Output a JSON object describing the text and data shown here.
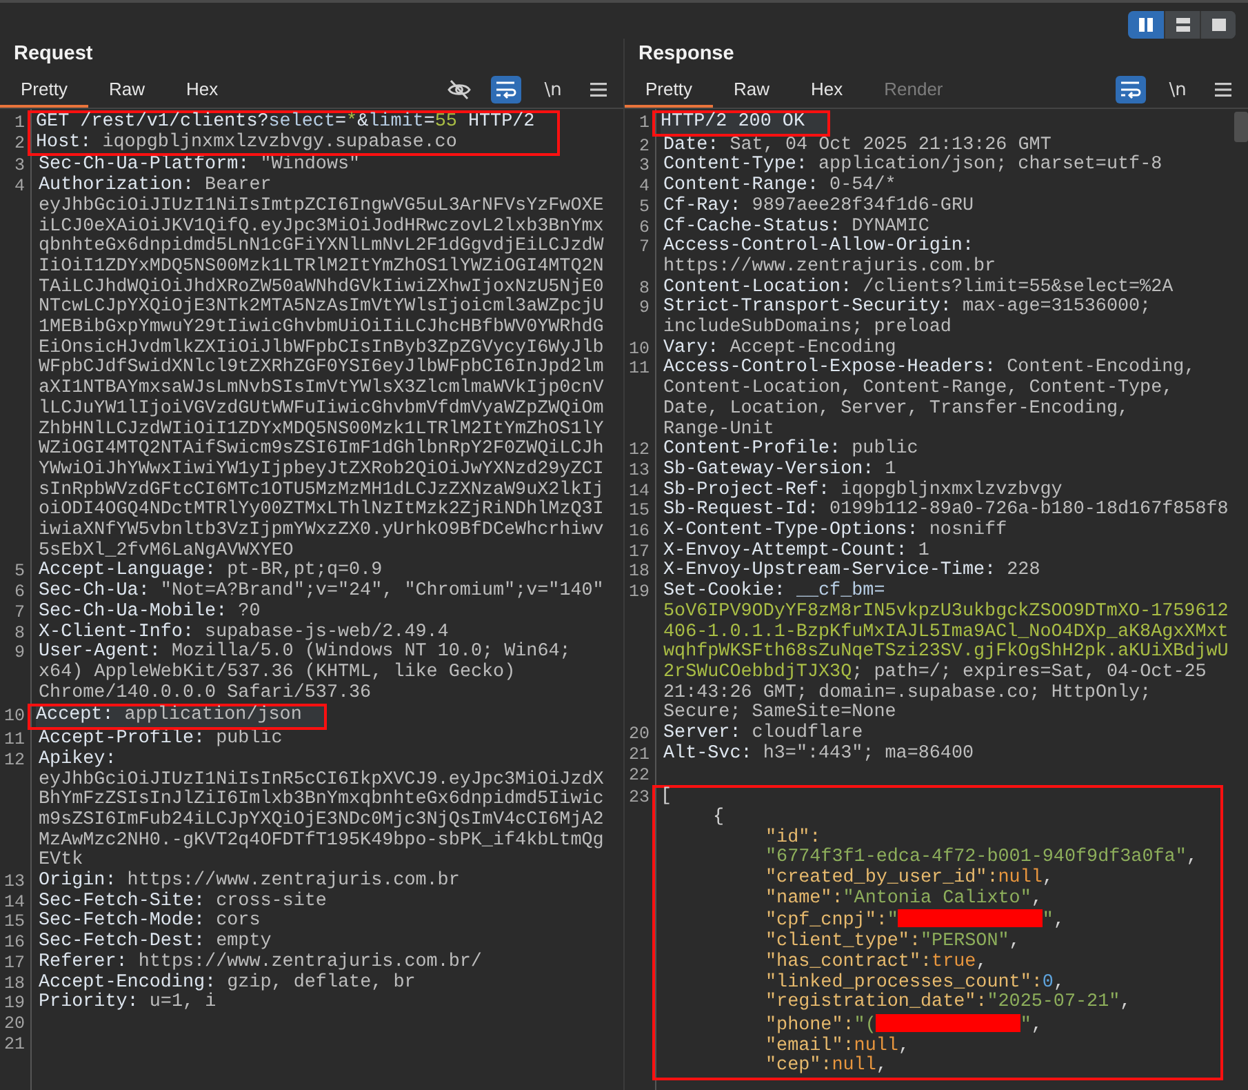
{
  "layout_buttons": [
    {
      "kind": "columns",
      "selected": true
    },
    {
      "kind": "rows",
      "selected": false
    },
    {
      "kind": "single",
      "selected": false
    }
  ],
  "request": {
    "title": "Request",
    "tabs": [
      {
        "label": "Pretty",
        "selected": true,
        "disabled": false
      },
      {
        "label": "Raw",
        "selected": false,
        "disabled": false
      },
      {
        "label": "Hex",
        "selected": false,
        "disabled": false
      }
    ],
    "tools": [
      {
        "kind": "hide",
        "on": false
      },
      {
        "kind": "wrap",
        "on": true
      },
      {
        "kind": "newline",
        "label": "\\n",
        "on": false
      },
      {
        "kind": "menu"
      }
    ],
    "lines": [
      {
        "n": "1",
        "highlighted": false,
        "boxed": true,
        "parts": [
          {
            "kind": "name",
            "text": "GET /rest/v1/clients?"
          },
          {
            "kind": "pname",
            "text": "select"
          },
          {
            "kind": "name",
            "text": "="
          },
          {
            "kind": "pval",
            "text": "*"
          },
          {
            "kind": "name",
            "text": "&"
          },
          {
            "kind": "pname",
            "text": "limit"
          },
          {
            "kind": "name",
            "text": "="
          },
          {
            "kind": "pval",
            "text": "55"
          },
          {
            "kind": "name",
            "text": " HTTP/2"
          }
        ]
      },
      {
        "n": "2",
        "highlighted": false,
        "boxed": true,
        "parts": [
          {
            "kind": "name",
            "text": "Host: "
          },
          {
            "kind": "value",
            "text": "iqopgbljnxmxlzvzbvgy.supabase.co"
          }
        ]
      },
      {
        "n": "3",
        "highlighted": false,
        "boxed": false,
        "parts": [
          {
            "kind": "name",
            "text": "Sec-Ch-Ua-Platform: "
          },
          {
            "kind": "value",
            "text": "\"Windows\""
          }
        ]
      },
      {
        "n": "4",
        "highlighted": false,
        "boxed": false,
        "parts": [
          {
            "kind": "name",
            "text": "Authorization: "
          },
          {
            "kind": "value",
            "text": "Bearer eyJhbGciOiJIUzI1NiIsImtpZCI6IngwVG5uL3ArNFVsYzFwOXEiLCJ0eXAiOiJKV1QifQ.eyJpc3MiOiJodHRwczovL2lxb3BnYmxqbnhteGx6dnpidmd5LnN1cGFiYXNlLmNvL2F1dGgvdjEiLCJzdWIiOiI1ZDYxMDQ5NS00Mzk1LTRlM2ItYmZhOS1lYWZiOGI4MTQ2NTAiLCJhdWQiOiJhdXRoZW50aWNhdGVkIiwiZXhwIjoxNzU5NjE0NTcwLCJpYXQiOjE3NTk2MTA5NzAsImVtYWlsIjoicml3aWZpcjU1MEBibGxpYmwuY29tIiwicGhvbmUiOiIiLCJhcHBfbWV0YWRhdGEiOnsicHJvdmlkZXIiOiJlbWFpbCIsInByb3ZpZGVycyI6WyJlbWFpbCJdfSwidXNlcl9tZXRhZGF0YSI6eyJlbWFpbCI6InJpd2lmaXI1NTBAYmxsaWJsLmNvbSIsImVtYWlsX3ZlcmlmaWVkIjp0cnVlLCJuYW1lIjoiVGVzdGUtWWFuIiwicGhvbmVfdmVyaWZpZWQiOmZhbHNlLCJzdWIiOiI1ZDYxMDQ5NS00Mzk1LTRlM2ItYmZhOS1lYWZiOGI4MTQ2NTAifSwicm9sZSI6ImF1dGhlbnRpY2F0ZWQiLCJhYWwiOiJhYWwxIiwiYW1yIjpbeyJtZXRob2QiOiJwYXNzd29yZCIsInRpbWVzdGFtcCI6MTc1OTU5MzMzMH1dLCJzZXNzaW9uX2lkIjoiODI4OGQ4NDctMTRlYy00ZTMxLThlNzItMzk2ZjRiNDhlMzQ3IiwiaXNfYW5vbnltb3VzIjpmYWxzZX0.yUrhkO9BfDCeWhcrhiwv5sEbXl_2fvM6LaNgAVWXYEO"
          }
        ]
      },
      {
        "n": "5",
        "highlighted": false,
        "boxed": false,
        "parts": [
          {
            "kind": "name",
            "text": "Accept-Language: "
          },
          {
            "kind": "value",
            "text": "pt-BR,pt;q=0.9"
          }
        ]
      },
      {
        "n": "6",
        "highlighted": false,
        "boxed": false,
        "parts": [
          {
            "kind": "name",
            "text": "Sec-Ch-Ua: "
          },
          {
            "kind": "value",
            "text": "\"Not=A?Brand\";v=\"24\", \"Chromium\";v=\"140\""
          }
        ]
      },
      {
        "n": "7",
        "highlighted": false,
        "boxed": false,
        "parts": [
          {
            "kind": "name",
            "text": "Sec-Ch-Ua-Mobile: "
          },
          {
            "kind": "value",
            "text": "?0"
          }
        ]
      },
      {
        "n": "8",
        "highlighted": false,
        "boxed": false,
        "parts": [
          {
            "kind": "name",
            "text": "X-Client-Info: "
          },
          {
            "kind": "value",
            "text": "supabase-js-web/2.49.4"
          }
        ]
      },
      {
        "n": "9",
        "highlighted": false,
        "boxed": false,
        "parts": [
          {
            "kind": "name",
            "text": "User-Agent: "
          },
          {
            "kind": "value",
            "text": "Mozilla/5.0 (Windows NT 10.0; Win64; x64) AppleWebKit/537.36 (KHTML, like Gecko) Chrome/140.0.0.0 Safari/537.36"
          }
        ]
      },
      {
        "n": "10",
        "highlighted": true,
        "boxed": true,
        "parts": [
          {
            "kind": "name",
            "text": "Accept: "
          },
          {
            "kind": "value",
            "text": "application/json"
          }
        ]
      },
      {
        "n": "11",
        "highlighted": false,
        "boxed": false,
        "parts": [
          {
            "kind": "name",
            "text": "Accept-Profile: "
          },
          {
            "kind": "value",
            "text": "public"
          }
        ]
      },
      {
        "n": "12",
        "highlighted": false,
        "boxed": false,
        "parts": [
          {
            "kind": "name",
            "text": "Apikey: "
          },
          {
            "kind": "value",
            "text": "eyJhbGciOiJIUzI1NiIsInR5cCI6IkpXVCJ9.eyJpc3MiOiJzdXBhYmFzZSIsInJlZiI6Imlxb3BnYmxqbnhteGx6dnpidmd5Iiwicm9sZSI6ImFub24iLCJpYXQiOjE3NDc0Mjc3NjQsImV4cCI6MjA2MzAwMzc2NH0.-gKVT2q4OFDTfT195K49bpo-sbPK_if4kbLtmQgEVtk"
          }
        ]
      },
      {
        "n": "13",
        "highlighted": false,
        "boxed": false,
        "parts": [
          {
            "kind": "name",
            "text": "Origin: "
          },
          {
            "kind": "value",
            "text": "https://www.zentrajuris.com.br"
          }
        ]
      },
      {
        "n": "14",
        "highlighted": false,
        "boxed": false,
        "parts": [
          {
            "kind": "name",
            "text": "Sec-Fetch-Site: "
          },
          {
            "kind": "value",
            "text": "cross-site"
          }
        ]
      },
      {
        "n": "15",
        "highlighted": false,
        "boxed": false,
        "parts": [
          {
            "kind": "name",
            "text": "Sec-Fetch-Mode: "
          },
          {
            "kind": "value",
            "text": "cors"
          }
        ]
      },
      {
        "n": "16",
        "highlighted": false,
        "boxed": false,
        "parts": [
          {
            "kind": "name",
            "text": "Sec-Fetch-Dest: "
          },
          {
            "kind": "value",
            "text": "empty"
          }
        ]
      },
      {
        "n": "17",
        "highlighted": false,
        "boxed": false,
        "parts": [
          {
            "kind": "name",
            "text": "Referer: "
          },
          {
            "kind": "value",
            "text": "https://www.zentrajuris.com.br/"
          }
        ]
      },
      {
        "n": "18",
        "highlighted": false,
        "boxed": false,
        "parts": [
          {
            "kind": "name",
            "text": "Accept-Encoding: "
          },
          {
            "kind": "value",
            "text": "gzip, deflate, br"
          }
        ]
      },
      {
        "n": "19",
        "highlighted": false,
        "boxed": false,
        "parts": [
          {
            "kind": "name",
            "text": "Priority: "
          },
          {
            "kind": "value",
            "text": "u=1, i"
          }
        ]
      },
      {
        "n": "20",
        "highlighted": false,
        "boxed": false
      },
      {
        "n": "21",
        "highlighted": false,
        "boxed": false
      }
    ]
  },
  "response": {
    "title": "Response",
    "tabs": [
      {
        "label": "Pretty",
        "selected": true,
        "disabled": false
      },
      {
        "label": "Raw",
        "selected": false,
        "disabled": false
      },
      {
        "label": "Hex",
        "selected": false,
        "disabled": false
      },
      {
        "label": "Render",
        "selected": false,
        "disabled": true
      }
    ],
    "tools": [
      {
        "kind": "wrap",
        "on": true
      },
      {
        "kind": "newline",
        "label": "\\n",
        "on": false
      },
      {
        "kind": "menu"
      }
    ],
    "lines": [
      {
        "n": "1",
        "highlighted": true,
        "boxed": true,
        "parts": [
          {
            "kind": "name",
            "text": "HTTP/2 200 OK"
          }
        ]
      },
      {
        "n": "2",
        "highlighted": false,
        "boxed": false,
        "parts": [
          {
            "kind": "name",
            "text": "Date: "
          },
          {
            "kind": "value",
            "text": "Sat, 04 Oct 2025 21:13:26 GMT"
          }
        ]
      },
      {
        "n": "3",
        "highlighted": false,
        "boxed": false,
        "parts": [
          {
            "kind": "name",
            "text": "Content-Type: "
          },
          {
            "kind": "value",
            "text": "application/json; charset=utf-8"
          }
        ]
      },
      {
        "n": "4",
        "highlighted": false,
        "boxed": false,
        "parts": [
          {
            "kind": "name",
            "text": "Content-Range: "
          },
          {
            "kind": "value",
            "text": "0-54/*"
          }
        ]
      },
      {
        "n": "5",
        "highlighted": false,
        "boxed": false,
        "parts": [
          {
            "kind": "name",
            "text": "Cf-Ray: "
          },
          {
            "kind": "value",
            "text": "9897aee28f34f1d6-GRU"
          }
        ]
      },
      {
        "n": "6",
        "highlighted": false,
        "boxed": false,
        "parts": [
          {
            "kind": "name",
            "text": "Cf-Cache-Status: "
          },
          {
            "kind": "value",
            "text": "DYNAMIC"
          }
        ]
      },
      {
        "n": "7",
        "highlighted": false,
        "boxed": false,
        "parts": [
          {
            "kind": "name",
            "text": "Access-Control-Allow-Origin: "
          },
          {
            "kind": "value",
            "text": "https://www.zentrajuris.com.br"
          }
        ]
      },
      {
        "n": "8",
        "highlighted": false,
        "boxed": false,
        "parts": [
          {
            "kind": "name",
            "text": "Content-Location: "
          },
          {
            "kind": "value",
            "text": "/clients?limit=55&select=%2A"
          }
        ]
      },
      {
        "n": "9",
        "highlighted": false,
        "boxed": false,
        "parts": [
          {
            "kind": "name",
            "text": "Strict-Transport-Security: "
          },
          {
            "kind": "value",
            "text": "max-age=31536000; includeSubDomains; preload"
          }
        ]
      },
      {
        "n": "10",
        "highlighted": false,
        "boxed": false,
        "parts": [
          {
            "kind": "name",
            "text": "Vary: "
          },
          {
            "kind": "value",
            "text": "Accept-Encoding"
          }
        ]
      },
      {
        "n": "11",
        "highlighted": false,
        "boxed": false,
        "parts": [
          {
            "kind": "name",
            "text": "Access-Control-Expose-Headers: "
          },
          {
            "kind": "value",
            "text": "Content-Encoding, Content-Location, Content-Range, Content-Type, Date, Location, Server, Transfer-Encoding, Range-Unit"
          }
        ]
      },
      {
        "n": "12",
        "highlighted": false,
        "boxed": false,
        "parts": [
          {
            "kind": "name",
            "text": "Content-Profile: "
          },
          {
            "kind": "value",
            "text": "public"
          }
        ]
      },
      {
        "n": "13",
        "highlighted": false,
        "boxed": false,
        "parts": [
          {
            "kind": "name",
            "text": "Sb-Gateway-Version: "
          },
          {
            "kind": "value",
            "text": "1"
          }
        ]
      },
      {
        "n": "14",
        "highlighted": false,
        "boxed": false,
        "parts": [
          {
            "kind": "name",
            "text": "Sb-Project-Ref: "
          },
          {
            "kind": "value",
            "text": "iqopgbljnxmxlzvzbvgy"
          }
        ]
      },
      {
        "n": "15",
        "highlighted": false,
        "boxed": false,
        "parts": [
          {
            "kind": "name",
            "text": "Sb-Request-Id: "
          },
          {
            "kind": "value",
            "text": "0199b112-89a0-726a-b180-18d167f858f8"
          }
        ]
      },
      {
        "n": "16",
        "highlighted": false,
        "boxed": false,
        "parts": [
          {
            "kind": "name",
            "text": "X-Content-Type-Options: "
          },
          {
            "kind": "value",
            "text": "nosniff"
          }
        ]
      },
      {
        "n": "17",
        "highlighted": false,
        "boxed": false,
        "parts": [
          {
            "kind": "name",
            "text": "X-Envoy-Attempt-Count: "
          },
          {
            "kind": "value",
            "text": "1"
          }
        ]
      },
      {
        "n": "18",
        "highlighted": false,
        "boxed": false,
        "parts": [
          {
            "kind": "name",
            "text": "X-Envoy-Upstream-Service-Time: "
          },
          {
            "kind": "value",
            "text": "228"
          }
        ]
      },
      {
        "n": "19",
        "highlighted": false,
        "boxed": false,
        "parts": [
          {
            "kind": "name",
            "text": "Set-Cookie: "
          },
          {
            "kind": "pname",
            "text": "__cf_bm="
          },
          {
            "kind": "pval",
            "text": "5oV6IPV9ODyYF8zM8rIN5vkpzU3ukbgckZSOO9DTmXO-1759612406-1.0.1.1-BzpKfuMxIAJL5Ima9ACl_NoO4DXp_aK8AgxXMxtwqhfpWKSFth68sZuNqeTSzi23SV.gjFkOgShH2pk.aKUiXBdjwU2rSWuCOebbdjTJX3Q"
          },
          {
            "kind": "value",
            "text": "; path=/; expires=Sat, 04-Oct-25 21:43:26 GMT; domain=.supabase.co; HttpOnly; Secure; SameSite=None"
          }
        ]
      },
      {
        "n": "20",
        "highlighted": false,
        "boxed": false,
        "parts": [
          {
            "kind": "name",
            "text": "Server: "
          },
          {
            "kind": "value",
            "text": "cloudflare"
          }
        ]
      },
      {
        "n": "21",
        "highlighted": false,
        "boxed": false,
        "parts": [
          {
            "kind": "name",
            "text": "Alt-Svc: "
          },
          {
            "kind": "value",
            "text": "h3=\":443\"; ma=86400"
          }
        ]
      },
      {
        "n": "22",
        "highlighted": false,
        "boxed": false
      },
      {
        "n": "23",
        "highlighted": false,
        "boxed": true,
        "parts": [
          {
            "kind": "punct",
            "text": "["
          }
        ],
        "children": [
          {
            "parts": [
              {
                "kind": "punct",
                "text": "{"
              }
            ],
            "children": [
              {
                "parts": [
                  {
                    "kind": "jkey",
                    "text": "\"id\":"
                  },
                  {
                    "kind": "jstr",
                    "text": "\"6774f3f1-edca-4f72-b001-940f9df3a0fa\""
                  },
                  {
                    "kind": "punct",
                    "text": ","
                  }
                ]
              },
              {
                "parts": [
                  {
                    "kind": "jkey",
                    "text": "\"created_by_user_id\":"
                  },
                  {
                    "kind": "jlit",
                    "text": "null"
                  },
                  {
                    "kind": "punct",
                    "text": ","
                  }
                ]
              },
              {
                "parts": [
                  {
                    "kind": "jkey",
                    "text": "\"name\":"
                  },
                  {
                    "kind": "jstr",
                    "text": "\"Antonia Calixto\""
                  },
                  {
                    "kind": "punct",
                    "text": ","
                  }
                ]
              },
              {
                "parts": [
                  {
                    "kind": "jkey",
                    "text": "\"cpf_cnpj\":"
                  },
                  {
                    "kind": "jstr",
                    "text": "\""
                  },
                  {
                    "kind": "redacted"
                  },
                  {
                    "kind": "jstr",
                    "text": "\""
                  },
                  {
                    "kind": "punct",
                    "text": ","
                  }
                ]
              },
              {
                "parts": [
                  {
                    "kind": "jkey",
                    "text": "\"client_type\":"
                  },
                  {
                    "kind": "jstr",
                    "text": "\"PERSON\""
                  },
                  {
                    "kind": "punct",
                    "text": ","
                  }
                ]
              },
              {
                "parts": [
                  {
                    "kind": "jkey",
                    "text": "\"has_contract\":"
                  },
                  {
                    "kind": "jlit",
                    "text": "true"
                  },
                  {
                    "kind": "punct",
                    "text": ","
                  }
                ]
              },
              {
                "parts": [
                  {
                    "kind": "jkey",
                    "text": "\"linked_processes_count\":"
                  },
                  {
                    "kind": "jnum",
                    "text": "0"
                  },
                  {
                    "kind": "punct",
                    "text": ","
                  }
                ]
              },
              {
                "parts": [
                  {
                    "kind": "jkey",
                    "text": "\"registration_date\":"
                  },
                  {
                    "kind": "jstr",
                    "text": "\"2025-07-21\""
                  },
                  {
                    "kind": "punct",
                    "text": ","
                  }
                ]
              },
              {
                "parts": [
                  {
                    "kind": "jkey",
                    "text": "\"phone\":"
                  },
                  {
                    "kind": "jstr",
                    "text": "\"("
                  },
                  {
                    "kind": "redacted"
                  },
                  {
                    "kind": "jstr",
                    "text": "\""
                  },
                  {
                    "kind": "punct",
                    "text": ","
                  }
                ]
              },
              {
                "parts": [
                  {
                    "kind": "jkey",
                    "text": "\"email\":"
                  },
                  {
                    "kind": "jlit",
                    "text": "null"
                  },
                  {
                    "kind": "punct",
                    "text": ","
                  }
                ]
              },
              {
                "parts": [
                  {
                    "kind": "jkey",
                    "text": "\"cep\":"
                  },
                  {
                    "kind": "jlit",
                    "text": "null"
                  },
                  {
                    "kind": "punct",
                    "text": ","
                  }
                ]
              }
            ]
          }
        ]
      }
    ]
  }
}
